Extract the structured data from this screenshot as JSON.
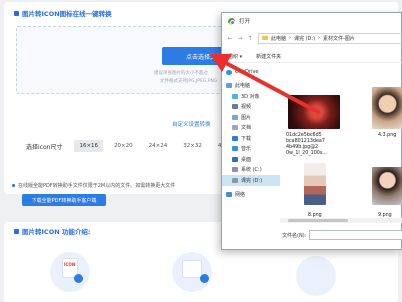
{
  "page": {
    "section1_title": "图片转ICON图标在线一键转换",
    "upload_button": "点击选择文件",
    "hint_line1": "建议单张图片的大小不超过",
    "hint_line2": "文件格式支持JPG,JPEG,PNG",
    "custom_link": "自定义设置转换",
    "size_label": "选择icon尺寸",
    "size_options": [
      "16×16",
      "20×20",
      "24×24",
      "32×32",
      "48×48"
    ],
    "notice_text": "在线版全能PDF转换助手文件仅限于2M以内的文件。如需转换更大文件",
    "download_button": "下载全能PDF转换助手客户端",
    "section2_title": "图片转ICON 功能介绍:",
    "illus_label": "ICON"
  },
  "dialog": {
    "title": "打开",
    "breadcrumb": [
      "此电脑",
      "课完 (D:)",
      "素材文件-图片"
    ],
    "toolbar": {
      "organize": "组织 ▾",
      "new_folder": "新建文件夹"
    },
    "nav_items": [
      {
        "label": "OneDrive",
        "icon": "cloud-icon"
      },
      {
        "label": "此电脑",
        "icon": "computer-icon"
      },
      {
        "label": "3D 对象",
        "icon": "cube-icon"
      },
      {
        "label": "视频",
        "icon": "video-icon"
      },
      {
        "label": "图片",
        "icon": "picture-icon"
      },
      {
        "label": "文档",
        "icon": "document-icon"
      },
      {
        "label": "下载",
        "icon": "download-icon"
      },
      {
        "label": "音乐",
        "icon": "music-icon"
      },
      {
        "label": "桌面",
        "icon": "desktop-icon"
      },
      {
        "label": "系统 (C:)",
        "icon": "drive-icon"
      },
      {
        "label": "课完 (D:)",
        "icon": "drive-icon"
      },
      {
        "label": "网络",
        "icon": "network-icon"
      }
    ],
    "files": [
      {
        "name_lines": [
          "01dc2e5bc6d5",
          "bca801213dea7",
          "4b49b.jpg@2",
          "0w_1l_20_100s..."
        ]
      },
      {
        "name_lines": [
          "4.3.png"
        ]
      },
      {
        "name_lines": [
          "8.png"
        ]
      },
      {
        "name_lines": [
          "9.png"
        ]
      }
    ],
    "filename_label": "文件名(N):"
  },
  "colors": {
    "accent": "#2d7be5",
    "arrow": "#e8312f"
  }
}
